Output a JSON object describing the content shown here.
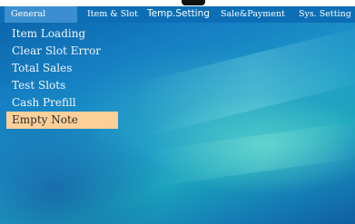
{
  "tabs": [
    {
      "label": "General"
    },
    {
      "label": "Item & Slot"
    },
    {
      "label": "Temp.Setting"
    },
    {
      "label": "Sale&Payment"
    },
    {
      "label": "Sys. Setting"
    }
  ],
  "menu": {
    "items": [
      {
        "label": "Item Loading"
      },
      {
        "label": "Clear Slot Error"
      },
      {
        "label": "Total Sales"
      },
      {
        "label": "Test Slots"
      },
      {
        "label": "Cash Prefill"
      },
      {
        "label": "Empty Note"
      }
    ],
    "selected": "Empty Note"
  },
  "colors": {
    "tab_bar": "#0c6fb6",
    "active_tab": "#3b8fd0",
    "selected_item": "#fdd09a"
  }
}
